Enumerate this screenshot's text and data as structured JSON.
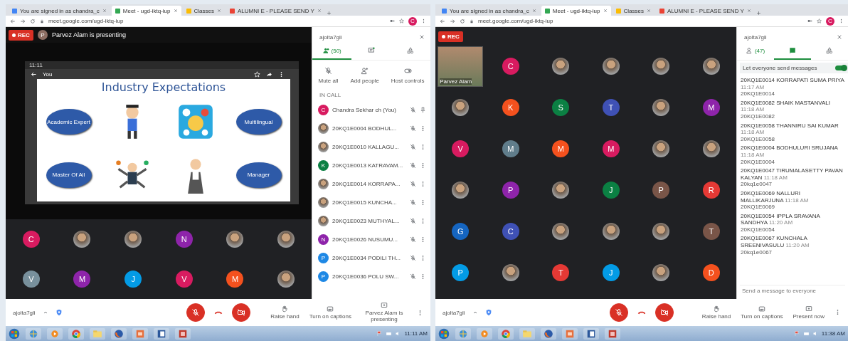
{
  "left": {
    "browser": {
      "tabs": [
        {
          "title": "You are signed in as chandra_c",
          "selected": false
        },
        {
          "title": "Meet - ugd-iktq-iup",
          "selected": true
        },
        {
          "title": "Classes",
          "selected": false
        },
        {
          "title": "ALUMNI E - PLEASE SEND Y",
          "selected": false
        }
      ],
      "url": "meet.google.com/ugd-iktq-iup",
      "profile": "C"
    },
    "recording": "REC",
    "presenter": {
      "initial": "P",
      "text": "Parvez Alam is presenting"
    },
    "screen": {
      "time": "11:11",
      "label": "You",
      "slide": {
        "title": "Industry Expectations",
        "bubbles": [
          "Academic Expert",
          "Multilingual",
          "Master Of All",
          "Manager"
        ]
      }
    },
    "tiles": [
      {
        "kind": "letter",
        "initial": "C",
        "color": "#d81b60"
      },
      {
        "kind": "photo"
      },
      {
        "kind": "photo"
      },
      {
        "kind": "letter",
        "initial": "N",
        "color": "#8e24aa"
      },
      {
        "kind": "photo"
      },
      {
        "kind": "photo"
      },
      {
        "kind": "letter",
        "initial": "V",
        "color": "#78909c"
      },
      {
        "kind": "letter",
        "initial": "M",
        "color": "#8e24aa"
      },
      {
        "kind": "letter",
        "initial": "J",
        "color": "#039be5"
      },
      {
        "kind": "letter",
        "initial": "V",
        "color": "#d81b60"
      },
      {
        "kind": "letter",
        "initial": "M",
        "color": "#f4511e"
      },
      {
        "kind": "photo"
      }
    ],
    "sidebar": {
      "title": "ajolta7gli",
      "tabs": [
        {
          "kind": "people",
          "label": "(50)",
          "selected": true
        },
        {
          "kind": "chat",
          "selected": false
        },
        {
          "kind": "activities",
          "selected": false
        }
      ],
      "actions": [
        {
          "kind": "mute",
          "label": "Mute all"
        },
        {
          "kind": "add",
          "label": "Add people"
        },
        {
          "kind": "host",
          "label": "Host controls"
        }
      ],
      "section": "IN CALL",
      "participants": [
        {
          "name": "Chandra Sekhar ch (You)",
          "self": true,
          "avatar": {
            "kind": "letter",
            "initial": "C",
            "color": "#d81b60"
          }
        },
        {
          "name": "20KQ1E0004 BODHUL...",
          "self": false,
          "avatar": {
            "kind": "photo"
          }
        },
        {
          "name": "20KQ1E0010 KALLAGU...",
          "self": false,
          "avatar": {
            "kind": "photo"
          }
        },
        {
          "name": "20KQ1E0013 KATRAVAM...",
          "self": false,
          "avatar": {
            "kind": "letter",
            "initial": "K",
            "color": "#0b8043"
          }
        },
        {
          "name": "20KQ1E0014 KORRAPA...",
          "self": false,
          "avatar": {
            "kind": "photo"
          }
        },
        {
          "name": "20KQ1E0015 KUNCHA...",
          "self": false,
          "avatar": {
            "kind": "photo"
          }
        },
        {
          "name": "20KQ1E0023 MUTHYAL...",
          "self": false,
          "avatar": {
            "kind": "photo"
          }
        },
        {
          "name": "20KQ1E0026 NUSUMU...",
          "self": false,
          "avatar": {
            "kind": "letter",
            "initial": "N",
            "color": "#8e24aa"
          }
        },
        {
          "name": "20KQ1E0034 PODILI TH...",
          "self": false,
          "avatar": {
            "kind": "letter",
            "initial": "P",
            "color": "#1e88e5"
          }
        },
        {
          "name": "20KQ1E0036 POLU SW...",
          "self": false,
          "avatar": {
            "kind": "letter",
            "initial": "P",
            "color": "#1e88e5"
          }
        }
      ]
    },
    "controls": {
      "user": "ajolta7gli",
      "mic_on": false,
      "camera_on": false,
      "actions": [
        {
          "kind": "hand",
          "label": "Raise hand"
        },
        {
          "kind": "captions",
          "label": "Turn on captions"
        },
        {
          "kind": "present",
          "label": "Parvez Alam is presenting"
        }
      ]
    },
    "taskbar": {
      "time": "11:11 AM"
    }
  },
  "right": {
    "browser": {
      "tabs": [
        {
          "title": "You are signed in as chandra_c",
          "selected": false
        },
        {
          "title": "Meet - ugd-iktq-iup",
          "selected": true
        },
        {
          "title": "Classes",
          "selected": false
        },
        {
          "title": "ALUMNI E - PLEASE SEND Y",
          "selected": false
        }
      ],
      "url": "meet.google.com/ugd-iktq-iup",
      "profile": "C"
    },
    "recording": "REC",
    "tiles": [
      {
        "kind": "video",
        "name": "Parvez Alam"
      },
      {
        "kind": "letter",
        "initial": "C",
        "color": "#d81b60"
      },
      {
        "kind": "photo"
      },
      {
        "kind": "photo"
      },
      {
        "kind": "photo"
      },
      {
        "kind": "photo"
      },
      {
        "kind": "photo"
      },
      {
        "kind": "letter",
        "initial": "K",
        "color": "#f4511e"
      },
      {
        "kind": "letter",
        "initial": "S",
        "color": "#0b8043"
      },
      {
        "kind": "letter",
        "initial": "T",
        "color": "#3f51b5"
      },
      {
        "kind": "photo"
      },
      {
        "kind": "letter",
        "initial": "M",
        "color": "#8e24aa"
      },
      {
        "kind": "letter",
        "initial": "V",
        "color": "#d81b60"
      },
      {
        "kind": "letter",
        "initial": "M",
        "color": "#607d8b"
      },
      {
        "kind": "letter",
        "initial": "M",
        "color": "#f4511e"
      },
      {
        "kind": "letter",
        "initial": "M",
        "color": "#d81b60"
      },
      {
        "kind": "photo"
      },
      {
        "kind": "photo"
      },
      {
        "kind": "photo"
      },
      {
        "kind": "letter",
        "initial": "P",
        "color": "#8e24aa"
      },
      {
        "kind": "photo"
      },
      {
        "kind": "letter",
        "initial": "J",
        "color": "#0b8043"
      },
      {
        "kind": "letter",
        "initial": "P",
        "color": "#795548"
      },
      {
        "kind": "letter",
        "initial": "R",
        "color": "#e53935"
      },
      {
        "kind": "letter",
        "initial": "G",
        "color": "#1565c0"
      },
      {
        "kind": "letter",
        "initial": "C",
        "color": "#3f51b5"
      },
      {
        "kind": "photo"
      },
      {
        "kind": "photo"
      },
      {
        "kind": "photo"
      },
      {
        "kind": "letter",
        "initial": "T",
        "color": "#795548"
      },
      {
        "kind": "letter",
        "initial": "P",
        "color": "#039be5"
      },
      {
        "kind": "photo"
      },
      {
        "kind": "letter",
        "initial": "T",
        "color": "#e53935"
      },
      {
        "kind": "letter",
        "initial": "J",
        "color": "#039be5"
      },
      {
        "kind": "photo"
      },
      {
        "kind": "letter",
        "initial": "D",
        "color": "#f4511e"
      }
    ],
    "sidebar": {
      "title": "ajolta7gli",
      "tabs": [
        {
          "kind": "people",
          "label": "(47)",
          "selected": false
        },
        {
          "kind": "chat",
          "selected": true
        },
        {
          "kind": "activities",
          "selected": false
        }
      ],
      "toggle": {
        "label": "Let everyone send messages",
        "on": true
      },
      "messages": [
        {
          "sender": "20KQ1E0014 KORRAPATI SUMA PRIYA",
          "time": "11:17 AM",
          "text": "20KQ1E0014"
        },
        {
          "sender": "20KQ1E0082 SHAIK MASTANVALI",
          "time": "11:18 AM",
          "text": "20KQ1E0082"
        },
        {
          "sender": "20KQ1E0058 THANNIRU SAI KUMAR",
          "time": "11:18 AM",
          "text": "20KQ1E0058"
        },
        {
          "sender": "20KQ1E0004 BODHULURI SRUJANA",
          "time": "11:18 AM",
          "text": "20KQ1E0004"
        },
        {
          "sender": "20KQ1E0047 TIRUMALASETTY PAVAN KALYAN",
          "time": "11:18 AM",
          "text": "20kq1e0047"
        },
        {
          "sender": "20KQ1E0069 NALLURI MALLIKARJUNA",
          "time": "11:18 AM",
          "text": "20KQ1E0069"
        },
        {
          "sender": "20KQ1E0054 IPPLA SRAVANA SANDHYA",
          "time": "11:20 AM",
          "text": "20KQ1E0054"
        },
        {
          "sender": "20KQ1E0067 KUNCHALA SREENIVASULU",
          "time": "11:20 AM",
          "text": "20kq1e0067"
        }
      ],
      "input": {
        "placeholder": "Send a message to everyone"
      }
    },
    "controls": {
      "user": "ajolta7gli",
      "mic_on": false,
      "camera_on": false,
      "actions": [
        {
          "kind": "hand",
          "label": "Raise hand"
        },
        {
          "kind": "captions",
          "label": "Turn on captions"
        },
        {
          "kind": "present",
          "label": "Present now"
        }
      ]
    },
    "taskbar": {
      "time": "11:38 AM"
    }
  }
}
